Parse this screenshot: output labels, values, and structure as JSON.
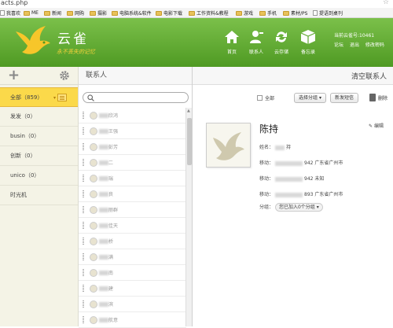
{
  "window": {
    "title": "acts.php"
  },
  "bookmarks": [
    {
      "label": "我喜欢",
      "icon": "page-icon"
    },
    {
      "label": "ME",
      "icon": "folder-icon"
    },
    {
      "label": "新闻",
      "icon": "folder-icon"
    },
    {
      "label": "网购",
      "icon": "folder-icon"
    },
    {
      "label": "摄影",
      "icon": "folder-icon"
    },
    {
      "label": "电脑系统&软件",
      "icon": "folder-icon"
    },
    {
      "label": "电影下载",
      "icon": "folder-icon"
    },
    {
      "label": "工作资料&教程",
      "icon": "folder-icon"
    },
    {
      "label": "游戏",
      "icon": "folder-icon"
    },
    {
      "label": "手机",
      "icon": "folder-icon"
    },
    {
      "label": "素材/PS",
      "icon": "folder-icon"
    },
    {
      "label": "提语到桌刊",
      "icon": "page-icon"
    }
  ],
  "header": {
    "brand": "云雀",
    "slogan": "永不丢失的记忆",
    "nav": [
      {
        "label": "首页",
        "icon": "home-icon"
      },
      {
        "label": "联系人",
        "icon": "contacts-icon"
      },
      {
        "label": "云存储",
        "icon": "sync-icon"
      },
      {
        "label": "备忘录",
        "icon": "box-icon"
      }
    ],
    "account": {
      "line1": "当前云雀号:10461",
      "links": [
        "论坛",
        "退出",
        "修改密码"
      ]
    }
  },
  "sidebar": {
    "groups": [
      {
        "label": "全部（859）",
        "active": true
      },
      {
        "label": "发发（0）"
      },
      {
        "label": "busin（0）"
      },
      {
        "label": "创新（0）"
      },
      {
        "label": "unico（0）"
      },
      {
        "label": "时光机"
      }
    ]
  },
  "list": {
    "title": "联系人",
    "search_placeholder": "",
    "contacts": [
      "欣鸿",
      "王强",
      "彭芳",
      "二",
      "瑞",
      "良",
      "丽群",
      "佳天",
      "桥",
      "满",
      "南",
      "建",
      "滨",
      "航意"
    ]
  },
  "panel": {
    "clear_label": "清空联系人",
    "select_all": "全部",
    "select_group": "选择分组",
    "new_contact": "新发短信",
    "delete": "删除"
  },
  "detail": {
    "name": "陈持",
    "edit": "编辑",
    "fields": [
      {
        "label": "姓名：",
        "value": "持"
      },
      {
        "label": "移动：",
        "value": "942 广东省广州市"
      },
      {
        "label": "移动：",
        "value": "942 未知"
      },
      {
        "label": "移动：",
        "value": "893 广东省广州市"
      }
    ],
    "group_label": "分组：",
    "group_value": "您已加入0个分组"
  },
  "colors": {
    "header_green": "#5fa82f",
    "active_yellow": "#fbd94a",
    "sidebar_bg": "#f4f3e6"
  }
}
